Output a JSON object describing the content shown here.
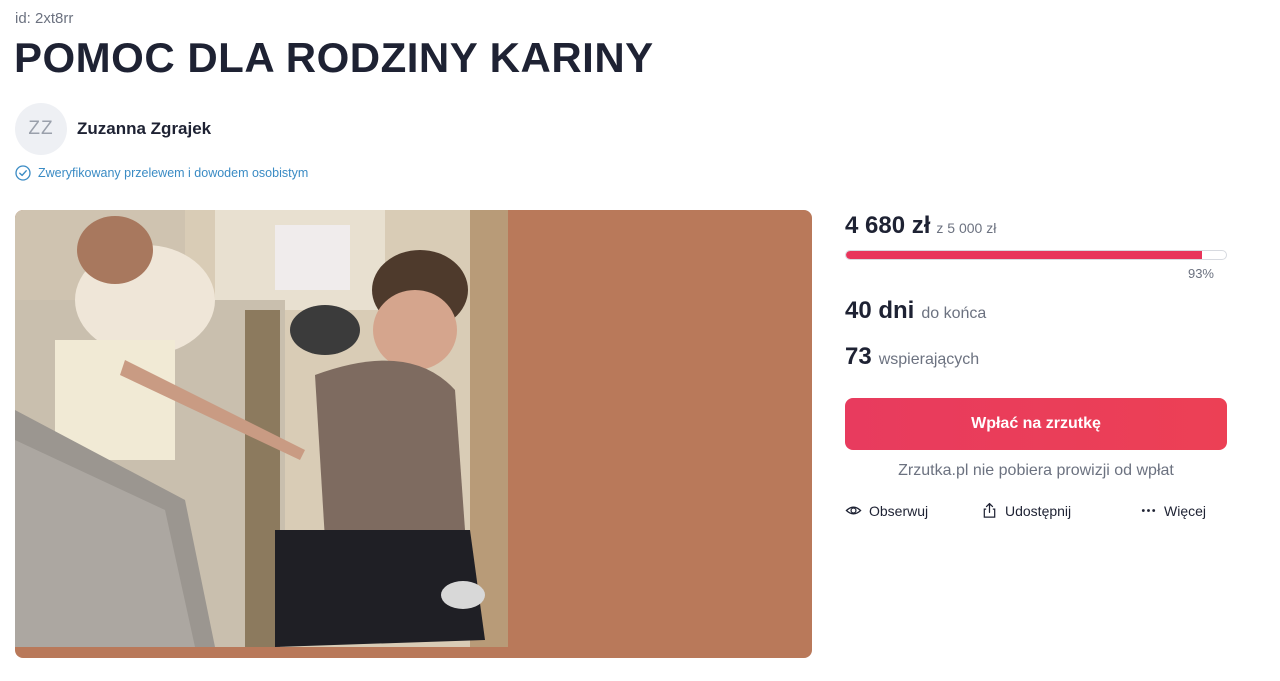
{
  "header": {
    "id_label": "id: 2xt8rr",
    "title": "POMOC DLA RODZINY KARINY"
  },
  "organizer": {
    "initials": "ZZ",
    "name": "Zuzanna Zgrajek",
    "verified_text": "Zweryfikowany przelewem i dowodem osobistym"
  },
  "stats": {
    "raised": "4 680 zł",
    "goal": "z 5 000 zł",
    "progress_fraction": 0.936,
    "percent_label": "93%",
    "days_value": "40 dni",
    "days_label": "do końca",
    "supporters_value": "73",
    "supporters_label": "wspierających"
  },
  "cta": {
    "donate_label": "Wpłać na zrzutkę",
    "no_fee_note": "Zrzutka.pl nie pobiera prowizji od wpłat"
  },
  "actions": {
    "watch_label": "Obserwuj",
    "share_label": "Udostępnij",
    "more_label": "Więcej"
  },
  "colors": {
    "accent": "#e8345b",
    "media_background": "#b9795a",
    "verified": "#3a8bc4"
  },
  "icons": {
    "verified": "check-circle-icon",
    "watch": "eye-icon",
    "share": "share-icon",
    "more": "more-dots-icon"
  }
}
